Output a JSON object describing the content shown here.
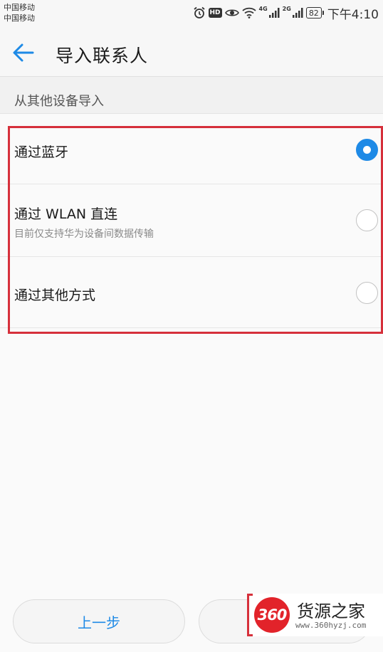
{
  "status_bar": {
    "carrier_1": "中国移动",
    "carrier_2": "中国移动",
    "net_4g": "4G",
    "net_2g": "2G",
    "battery": "82",
    "time": "下午4:10",
    "icons": [
      "alarm-icon",
      "hd-icon",
      "eye-comfort-icon",
      "wifi-icon",
      "signal-icon",
      "signal-icon",
      "battery-icon"
    ]
  },
  "app_bar": {
    "title": "导入联系人",
    "back_icon": "arrow-left-icon"
  },
  "section": {
    "title": "从其他设备导入"
  },
  "options": [
    {
      "label": "通过蓝牙",
      "subtitle": "",
      "selected": true
    },
    {
      "label": "通过 WLAN 直连",
      "subtitle": "目前仅支持华为设备间数据传输",
      "selected": false
    },
    {
      "label": "通过其他方式",
      "subtitle": "",
      "selected": false
    }
  ],
  "buttons": {
    "prev": "上一步"
  },
  "watermark": {
    "logo": "360",
    "brand": "货源之家",
    "url": "www.360hyzj.com"
  },
  "colors": {
    "accent": "#1e8ae6",
    "highlight": "#d6303b",
    "logo_red": "#e2232a"
  }
}
